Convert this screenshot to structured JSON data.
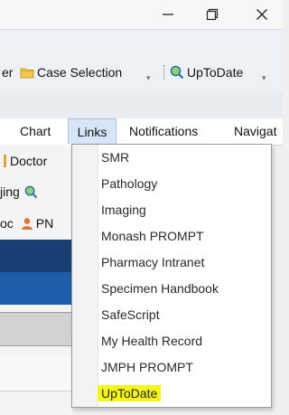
{
  "toolbar": {
    "partial_left": "er",
    "case_selection": "Case Selection",
    "uptodate": "UpToDate",
    "arrow": "▾"
  },
  "menubar": {
    "items": [
      "Chart",
      "Links",
      "Notifications",
      "Navigat"
    ]
  },
  "leftpanel": {
    "row1": "Doctor",
    "row2": "jing",
    "row3_a": "oc",
    "row3_b": "PN"
  },
  "links_menu": {
    "items": [
      "SMR",
      "Pathology",
      "Imaging",
      "Monash PROMPT",
      "Pharmacy Intranet",
      "Specimen Handbook",
      "SafeScript",
      "My Health Record",
      "JMPH PROMPT",
      "UpToDate"
    ],
    "highlight_color": "#f4f51a"
  },
  "icons": {
    "minimize": "minimize-icon",
    "restore": "restore-icon",
    "close": "close-icon",
    "folder": "folder-icon",
    "search": "search-icon",
    "user": "user-icon"
  }
}
